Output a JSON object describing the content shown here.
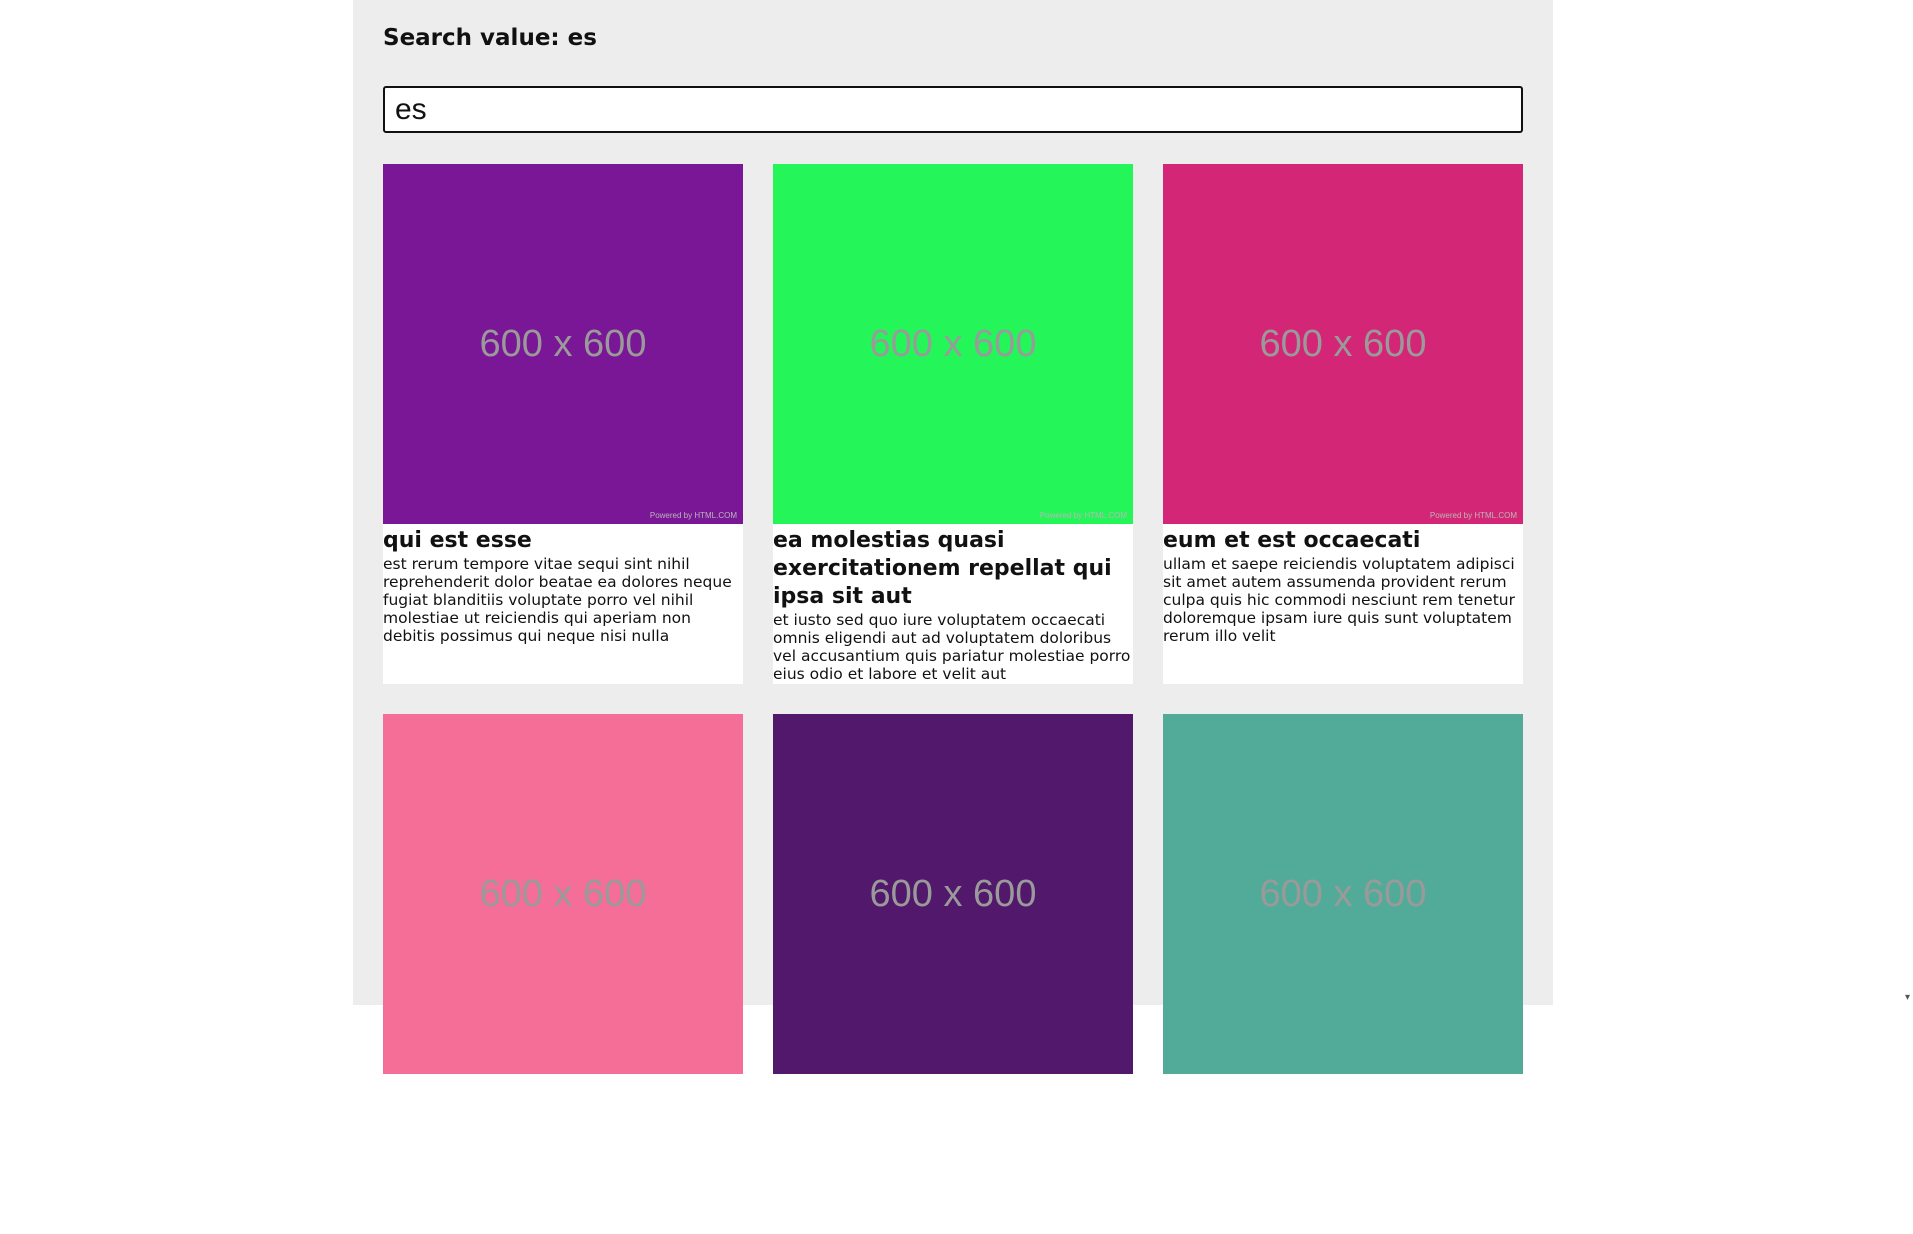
{
  "header": {
    "title": "Search value: es"
  },
  "search": {
    "value": "es"
  },
  "cards": [
    {
      "image_label": "600 x 600",
      "image_footer": "Powered by HTML.COM",
      "color": "#7a1796",
      "title": "qui est esse",
      "body": "est rerum tempore vitae sequi sint nihil reprehenderit dolor beatae ea dolores neque fugiat blanditiis voluptate porro vel nihil molestiae ut reiciendis qui aperiam non debitis possimus qui neque nisi nulla"
    },
    {
      "image_label": "600 x 600",
      "image_footer": "Powered by HTML.COM",
      "color": "#24f558",
      "title": "ea molestias quasi exercitationem repellat qui ipsa sit aut",
      "body": "et iusto sed quo iure voluptatem occaecati omnis eligendi aut ad voluptatem doloribus vel accusantium quis pariatur molestiae porro eius odio et labore et velit aut"
    },
    {
      "image_label": "600 x 600",
      "image_footer": "Powered by HTML.COM",
      "color": "#d42677",
      "title": "eum et est occaecati",
      "body": "ullam et saepe reiciendis voluptatem adipisci sit amet autem assumenda provident rerum culpa quis hic commodi nesciunt rem tenetur doloremque ipsam iure quis sunt voluptatem rerum illo velit"
    },
    {
      "image_label": "600 x 600",
      "image_footer": "",
      "color": "#f56e98",
      "title": "",
      "body": ""
    },
    {
      "image_label": "600 x 600",
      "image_footer": "",
      "color": "#52186b",
      "title": "",
      "body": ""
    },
    {
      "image_label": "600 x 600",
      "image_footer": "",
      "color": "#52ab98",
      "title": "",
      "body": ""
    }
  ],
  "scrollbar": {
    "down_arrow": "▾"
  }
}
